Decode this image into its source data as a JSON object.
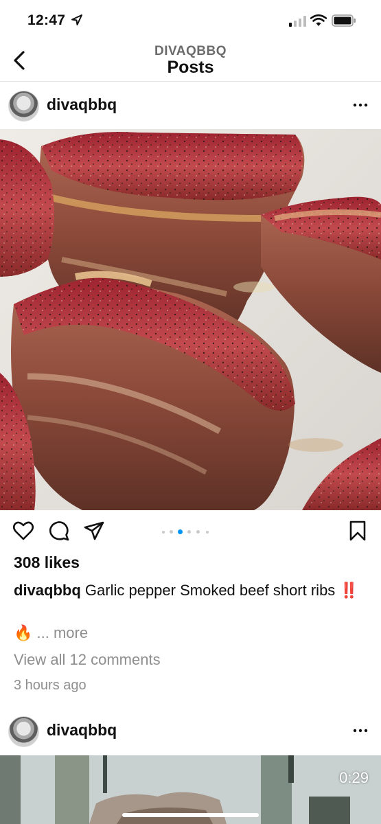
{
  "status_bar": {
    "time": "12:47",
    "icons": [
      "location-arrow-icon",
      "signal-icon",
      "wifi-icon",
      "battery-icon"
    ]
  },
  "nav": {
    "subtitle": "DIVAQBBQ",
    "title": "Posts",
    "back_icon": "chevron-left-icon"
  },
  "posts": [
    {
      "username": "divaqbbq",
      "likes": "308 likes",
      "caption_user": "divaqbbq",
      "caption_text": "Garlic pepper Smoked beef short ribs",
      "caption_emoji": "‼️",
      "caption_more_prefix": "🔥",
      "more_label": "... more",
      "view_comments": "View all 12 comments",
      "time_ago": "3 hours ago",
      "carousel": {
        "count": 6,
        "active_index": 1
      }
    },
    {
      "username": "divaqbbq",
      "video_duration": "0:29"
    }
  ],
  "colors": {
    "accent_dot": "#0095f6",
    "muted_text": "#8e8e8e",
    "text": "#111111"
  }
}
